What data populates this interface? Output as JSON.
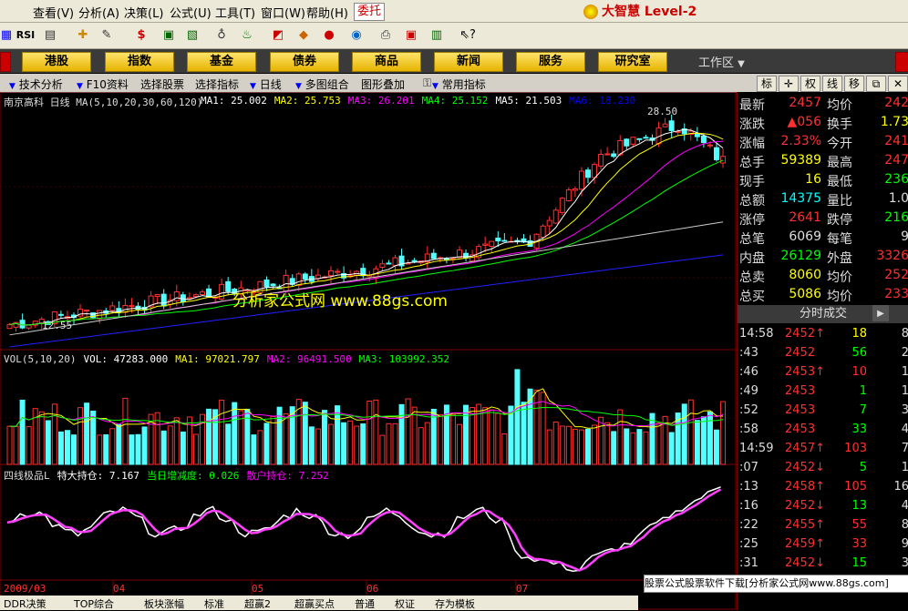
{
  "menu": {
    "items": [
      "查看(V)",
      "分析(A)",
      "决策(L)",
      "公式(U)",
      "工具(T)",
      "窗口(W)",
      "帮助(H)"
    ],
    "entrust": "委托",
    "brand": "大智慧 Level-2"
  },
  "nav": {
    "buttons": [
      "港股",
      "指数",
      "基金",
      "债券",
      "商品",
      "新闻",
      "服务",
      "研究室"
    ],
    "workarea": "工作区"
  },
  "funcbar": {
    "items": [
      "技术分析",
      "F10资料",
      "选择股票",
      "选择指标",
      "日线",
      "多图组合",
      "图形叠加",
      "常用指标"
    ]
  },
  "chart_data": [
    {
      "type": "candlestick",
      "title": "南京高科 日线",
      "indicator": "MA(5,10,20,30,60,120)",
      "ma_legend": [
        {
          "name": "MA1",
          "value": "25.002",
          "color": "#ffffff"
        },
        {
          "name": "MA2",
          "value": "25.753",
          "color": "#ffff00"
        },
        {
          "name": "MA3",
          "value": "26.201",
          "color": "#ff00ff"
        },
        {
          "name": "MA4",
          "value": "25.152",
          "color": "#00ff00"
        },
        {
          "name": "MA5",
          "value": "21.503",
          "color": "#ffffff"
        },
        {
          "name": "MA6",
          "value": "18.230",
          "color": "#0000ff"
        }
      ],
      "y_range": [
        11.5,
        29.5
      ],
      "annotations": [
        "28.50",
        "12.55"
      ],
      "x_labels": [
        "2009/03",
        "04",
        "05",
        "06",
        "07"
      ]
    },
    {
      "type": "bar",
      "title": "VOL(5,10,20)",
      "legend": [
        {
          "name": "VOL",
          "value": "47283.000",
          "color": "#ffffff"
        },
        {
          "name": "MA1",
          "value": "97021.797",
          "color": "#ffff00"
        },
        {
          "name": "MA2",
          "value": "96491.500",
          "color": "#ff00ff"
        },
        {
          "name": "MA3",
          "value": "103992.352",
          "color": "#00ff00"
        }
      ]
    },
    {
      "type": "line",
      "title": "四线极品L",
      "legend": [
        {
          "name": "特大持仓",
          "value": "7.167",
          "color": "#ffffff"
        },
        {
          "name": "当日增减度",
          "value": "0.026",
          "color": "#00ff00"
        },
        {
          "name": "散户持仓",
          "value": "7.252",
          "color": "#ff00ff"
        }
      ]
    }
  ],
  "watermark": "分析家公式网 www.88gs.com",
  "quote": {
    "rows": [
      {
        "l1": "最新",
        "v1": "2457",
        "c1": "#ff3030",
        "l2": "均价",
        "v2": "242",
        "c2": "#ff3030"
      },
      {
        "l1": "涨跌",
        "v1": "▲056",
        "c1": "#ff3030",
        "l2": "换手",
        "v2": "1.73",
        "c2": "#ffff00"
      },
      {
        "l1": "涨幅",
        "v1": "2.33%",
        "c1": "#ff3030",
        "l2": "今开",
        "v2": "241",
        "c2": "#ff3030"
      },
      {
        "l1": "总手",
        "v1": "59389",
        "c1": "#ffff00",
        "l2": "最高",
        "v2": "247",
        "c2": "#ff3030"
      },
      {
        "l1": "现手",
        "v1": "16",
        "c1": "#ffff00",
        "l2": "最低",
        "v2": "236",
        "c2": "#00ff00"
      },
      {
        "l1": "总额",
        "v1": "14375",
        "c1": "#00ffff",
        "l2": "量比",
        "v2": "1.0",
        "c2": "#ddd"
      },
      {
        "l1": "涨停",
        "v1": "2641",
        "c1": "#ff3030",
        "l2": "跌停",
        "v2": "216",
        "c2": "#00ff00"
      },
      {
        "l1": "总笔",
        "v1": "6069",
        "c1": "#ddd",
        "l2": "每笔",
        "v2": "9",
        "c2": "#ddd"
      },
      {
        "l1": "内盘",
        "v1": "26129",
        "c1": "#00ff00",
        "l2": "外盘",
        "v2": "3326",
        "c2": "#ff3030"
      },
      {
        "l1": "总卖",
        "v1": "8060",
        "c1": "#ffff00",
        "l2": "均价",
        "v2": "252",
        "c2": "#ff3030"
      },
      {
        "l1": "总买",
        "v1": "5086",
        "c1": "#ffff00",
        "l2": "均价",
        "v2": "233",
        "c2": "#ff3030"
      }
    ],
    "trades_title": "分时成交",
    "trades": [
      {
        "t": "14:58",
        "p": "2452",
        "a": "↑",
        "v": "18",
        "n": "8",
        "pc": "#ff3030",
        "vc": "#ffff00"
      },
      {
        "t": ":43",
        "p": "2452",
        "a": "",
        "v": "56",
        "n": "2",
        "pc": "#ff3030",
        "vc": "#00ff00"
      },
      {
        "t": ":46",
        "p": "2453",
        "a": "↑",
        "v": "10",
        "n": "1",
        "pc": "#ff3030",
        "vc": "#ff3030"
      },
      {
        "t": ":49",
        "p": "2453",
        "a": "",
        "v": "1",
        "n": "1",
        "pc": "#ff3030",
        "vc": "#00ff00"
      },
      {
        "t": ":52",
        "p": "2453",
        "a": "",
        "v": "7",
        "n": "3",
        "pc": "#ff3030",
        "vc": "#00ff00"
      },
      {
        "t": ":58",
        "p": "2453",
        "a": "",
        "v": "33",
        "n": "4",
        "pc": "#ff3030",
        "vc": "#00ff00"
      },
      {
        "t": "14:59",
        "p": "2457",
        "a": "↑",
        "v": "103",
        "n": "7",
        "pc": "#ff3030",
        "vc": "#ff3030"
      },
      {
        "t": ":07",
        "p": "2452",
        "a": "↓",
        "v": "5",
        "n": "1",
        "pc": "#ff3030",
        "vc": "#00ff00"
      },
      {
        "t": ":13",
        "p": "2458",
        "a": "↑",
        "v": "105",
        "n": "16",
        "pc": "#ff3030",
        "vc": "#ff3030"
      },
      {
        "t": ":16",
        "p": "2452",
        "a": "↓",
        "v": "13",
        "n": "4",
        "pc": "#ff3030",
        "vc": "#00ff00"
      },
      {
        "t": ":22",
        "p": "2455",
        "a": "↑",
        "v": "55",
        "n": "8",
        "pc": "#ff3030",
        "vc": "#ff3030"
      },
      {
        "t": ":25",
        "p": "2459",
        "a": "↑",
        "v": "33",
        "n": "9",
        "pc": "#ff3030",
        "vc": "#ff3030"
      },
      {
        "t": ":31",
        "p": "2452",
        "a": "↓",
        "v": "15",
        "n": "3",
        "pc": "#ff3030",
        "vc": "#00ff00"
      }
    ]
  },
  "right_tabs": [
    "标",
    "权",
    "线",
    "移"
  ],
  "footad": "股票公式股票软件下载[分析家公式网www.88gs.com]",
  "bottombar": [
    "DDR决策",
    "TOP综合",
    "板块涨幅",
    "标准",
    "超赢2",
    "超赢买点",
    "普通",
    "权证",
    "存为模板"
  ]
}
